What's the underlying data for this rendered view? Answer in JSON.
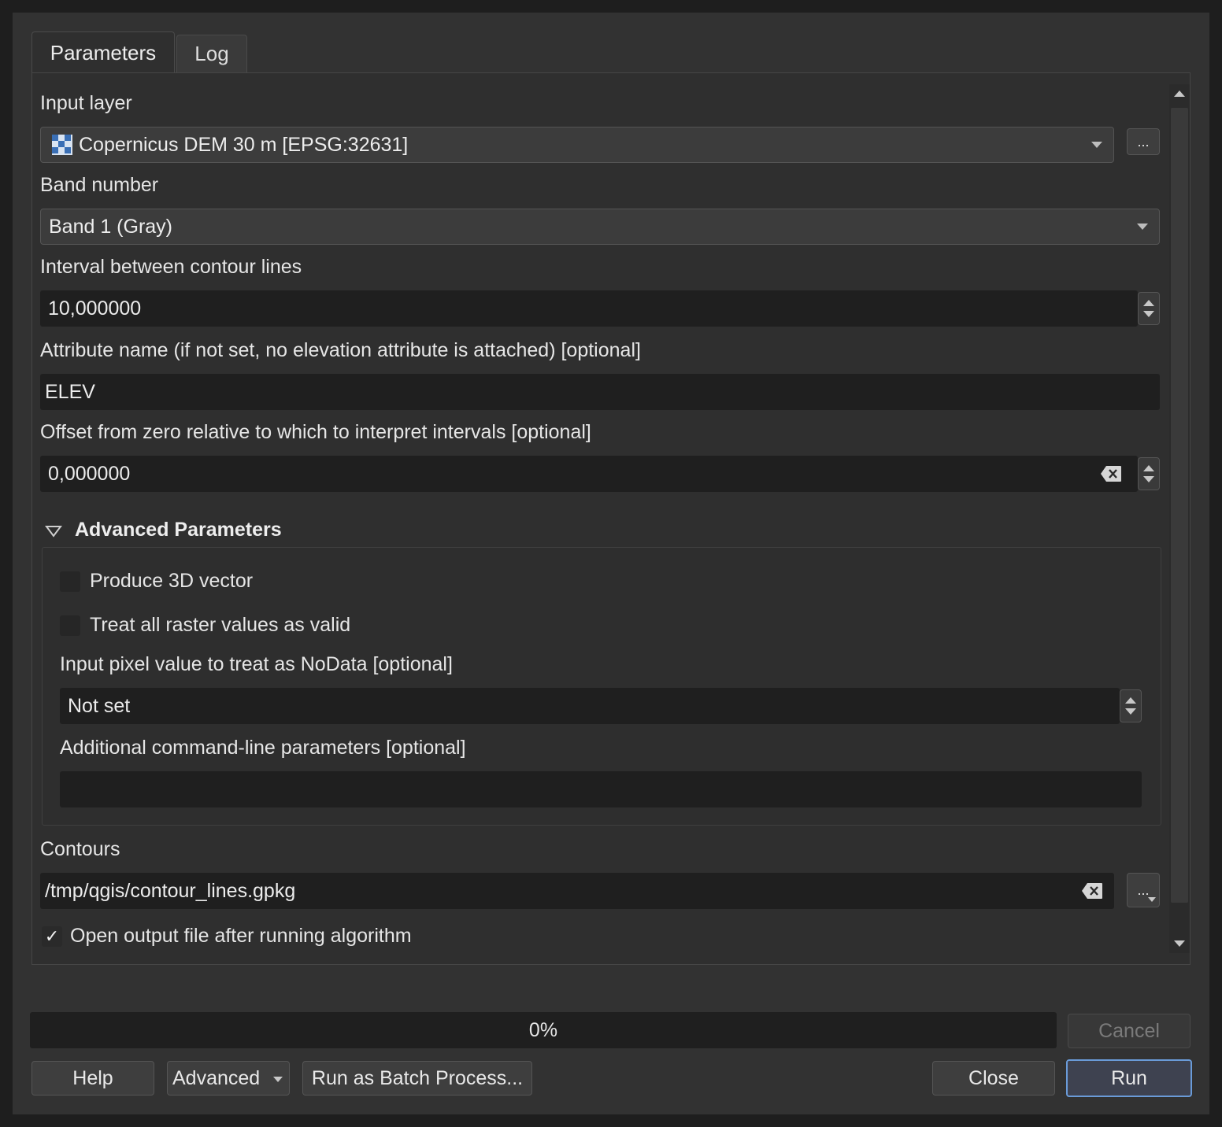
{
  "tabs": {
    "parameters": "Parameters",
    "log": "Log"
  },
  "fields": {
    "input_layer": {
      "label": "Input layer",
      "value": "Copernicus DEM 30 m [EPSG:32631]",
      "browse": "..."
    },
    "band": {
      "label": "Band number",
      "value": "Band 1 (Gray)"
    },
    "interval": {
      "label": "Interval between contour lines",
      "value": "10,000000"
    },
    "attribute": {
      "label": "Attribute name (if not set, no elevation attribute is attached) [optional]",
      "value": "ELEV"
    },
    "offset": {
      "label": "Offset from zero relative to which to interpret intervals [optional]",
      "value": "0,000000"
    }
  },
  "advanced": {
    "title": "Advanced Parameters",
    "produce_3d": {
      "label": "Produce 3D vector",
      "checked": false
    },
    "treat_valid": {
      "label": "Treat all raster values as valid",
      "checked": false
    },
    "nodata": {
      "label": "Input pixel value to treat as NoData [optional]",
      "value": "Not set"
    },
    "extra": {
      "label": "Additional command-line parameters [optional]",
      "value": ""
    }
  },
  "output": {
    "label": "Contours",
    "value": "/tmp/qgis/contour_lines.gpkg",
    "browse": "...",
    "open_after": {
      "label": "Open output file after running algorithm",
      "checked": true,
      "mark": "✓"
    }
  },
  "progress": {
    "text": "0%",
    "value": 0
  },
  "buttons": {
    "cancel": "Cancel",
    "help": "Help",
    "advanced": "Advanced",
    "batch": "Run as Batch Process...",
    "close": "Close",
    "run": "Run"
  },
  "colors": {
    "accent_border": "#6a9bd8",
    "background": "#323232"
  }
}
